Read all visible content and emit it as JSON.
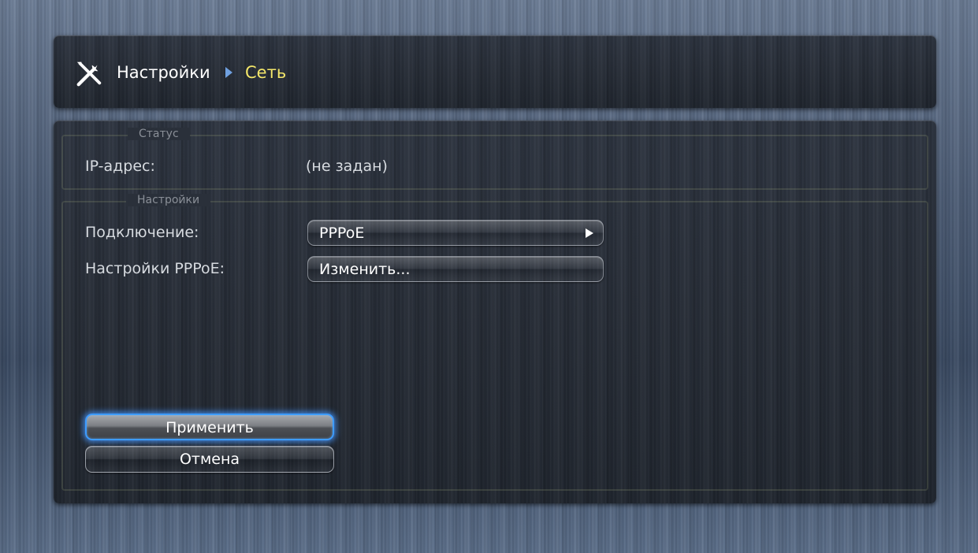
{
  "header": {
    "icon": "tools-icon",
    "breadcrumb_root": "Настройки",
    "breadcrumb_separator_icon": "triangle-right-icon",
    "breadcrumb_current": "Сеть",
    "current_color": "#f4e76a"
  },
  "status_group": {
    "legend": "Статус",
    "ip_label": "IP-адрес:",
    "ip_value": "(не задан)"
  },
  "settings_group": {
    "legend": "Настройки",
    "connection_label": "Подключение:",
    "connection_value": "PPPoE",
    "connection_arrow_icon": "triangle-right-icon",
    "pppoe_label": "Настройки PPPoE:",
    "pppoe_button": "Изменить..."
  },
  "actions": {
    "apply": "Применить",
    "cancel": "Отмена",
    "focus_color": "#3e9cff"
  }
}
